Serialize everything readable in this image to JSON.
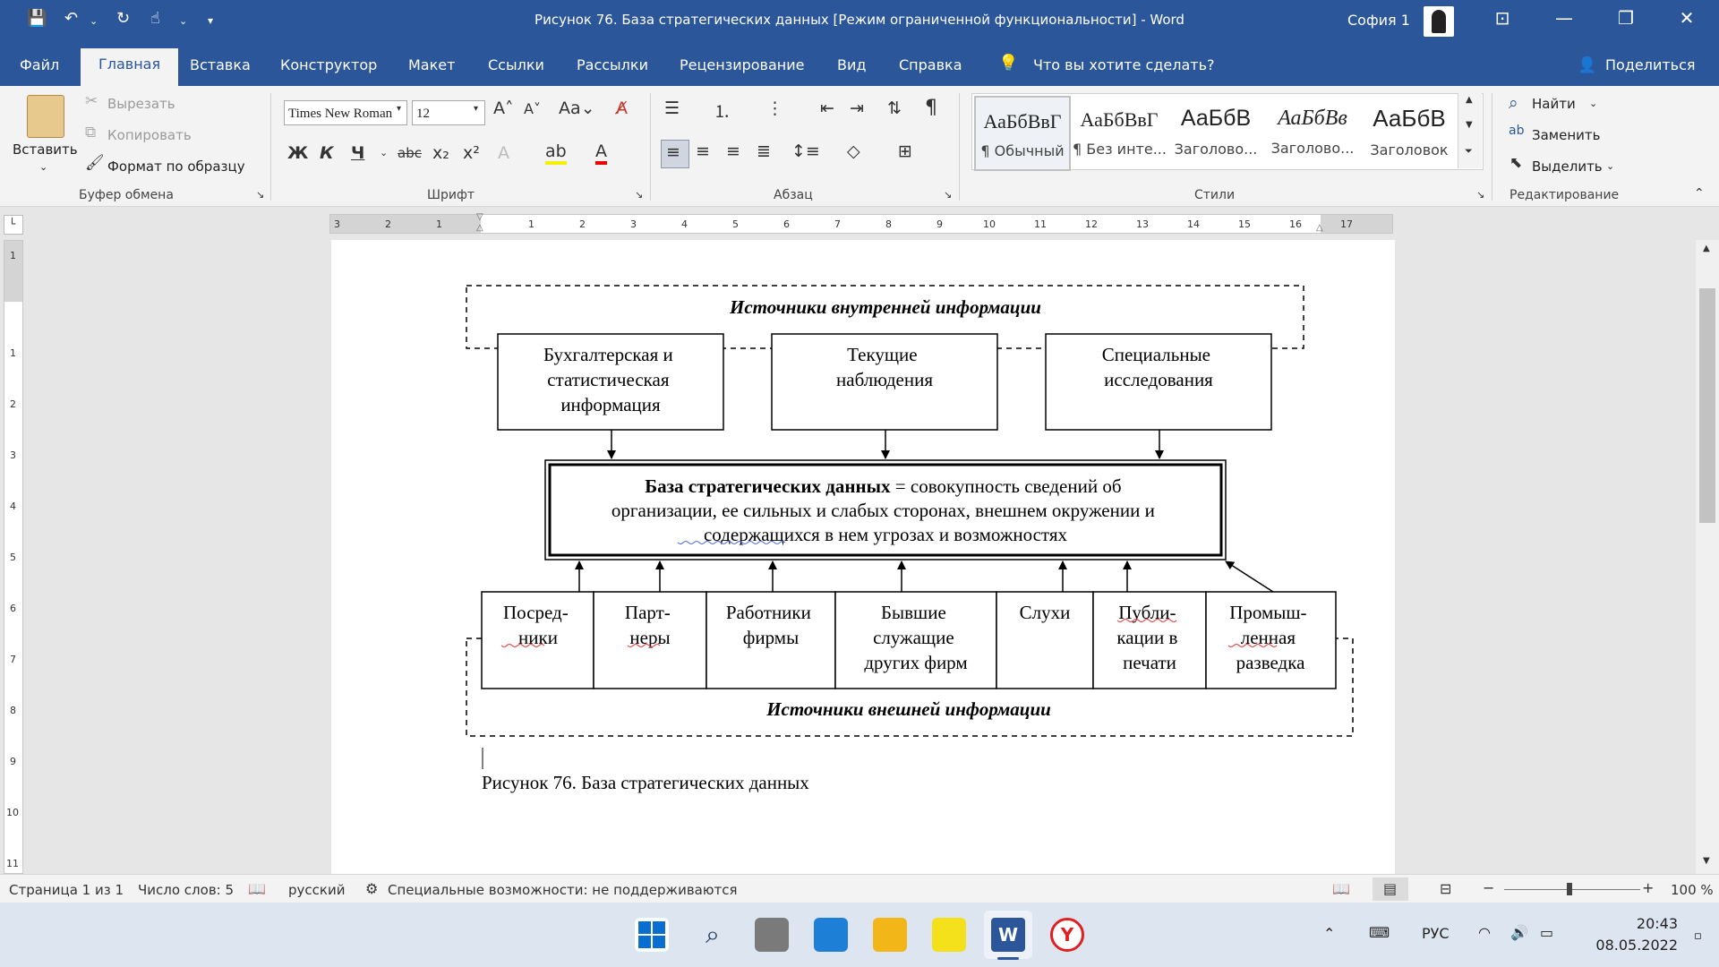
{
  "titlebar": {
    "title": "Рисунок 76. База стратегических данных [Режим ограниченной функциональности]  -  Word",
    "user": "София 1"
  },
  "tabs": [
    "Файл",
    "Главная",
    "Вставка",
    "Конструктор",
    "Макет",
    "Ссылки",
    "Рассылки",
    "Рецензирование",
    "Вид",
    "Справка"
  ],
  "active_tab": "Главная",
  "tell_me": "Что вы хотите сделать?",
  "share": "Поделиться",
  "ribbon": {
    "clipboard": {
      "paste": "Вставить",
      "cut": "Вырезать",
      "copy": "Копировать",
      "format_painter": "Формат по образцу",
      "group_label": "Буфер обмена"
    },
    "font": {
      "name": "Times New Roman",
      "size": "12",
      "group_label": "Шрифт"
    },
    "paragraph": {
      "group_label": "Абзац"
    },
    "styles": {
      "items": [
        {
          "sample": "АаБбВвГ",
          "name": "¶ Обычный"
        },
        {
          "sample": "АаБбВвГ",
          "name": "¶ Без инте..."
        },
        {
          "sample": "АаБбВ",
          "name": "Заголово..."
        },
        {
          "sample": "АаБбВв",
          "name": "Заголово..."
        },
        {
          "sample": "АаБбВ",
          "name": "Заголовок"
        }
      ],
      "group_label": "Стили"
    },
    "editing": {
      "find": "Найти",
      "replace": "Заменить",
      "select": "Выделить",
      "group_label": "Редактирование"
    }
  },
  "ruler": {
    "h_ticks": [
      "3",
      "2",
      "1",
      "1",
      "2",
      "3",
      "4",
      "5",
      "6",
      "7",
      "8",
      "9",
      "10",
      "11",
      "12",
      "13",
      "14",
      "15",
      "16",
      "17"
    ],
    "v_ticks": [
      "1",
      "1",
      "2",
      "3",
      "4",
      "5",
      "6",
      "7",
      "8",
      "9",
      "10",
      "11"
    ]
  },
  "document": {
    "internal_header": "Источники внутренней информации",
    "internal_boxes": [
      [
        "Бухгалтерская и",
        "статистическая",
        "информация"
      ],
      [
        "Текущие",
        "наблюдения"
      ],
      [
        "Специальные",
        "исследования"
      ]
    ],
    "central": {
      "bold": "База стратегических данных",
      "line1_rest": " = совокупность сведений об",
      "line2": "организации, ее сильных и слабых сторонах, внешнем окружении и",
      "line3": "содержащихся в нем угрозах и возможностях"
    },
    "external_boxes": [
      [
        "Посред-",
        "ники"
      ],
      [
        "Парт-",
        "неры"
      ],
      [
        "Работники",
        "фирмы"
      ],
      [
        "Бывшие",
        "служащие",
        "других фирм"
      ],
      [
        "Слухи"
      ],
      [
        "Публи-",
        "кации в",
        "печати"
      ],
      [
        "Промыш-",
        "ленная",
        "разведка"
      ]
    ],
    "external_header": "Источники внешней информации",
    "caption": "Рисунок 76. База стратегических данных"
  },
  "status": {
    "page": "Страница 1 из 1",
    "words": "Число слов: 5",
    "language": "русский",
    "accessibility": "Специальные возможности: не поддерживаются",
    "zoom": "100 %"
  },
  "taskbar": {
    "lang": "РУС",
    "time": "20:43",
    "date": "08.05.2022"
  },
  "colors": {
    "word_blue": "#2b579a",
    "ribbon_bg": "#f3f3f3",
    "taskbar_bg": "#dde5f0"
  }
}
